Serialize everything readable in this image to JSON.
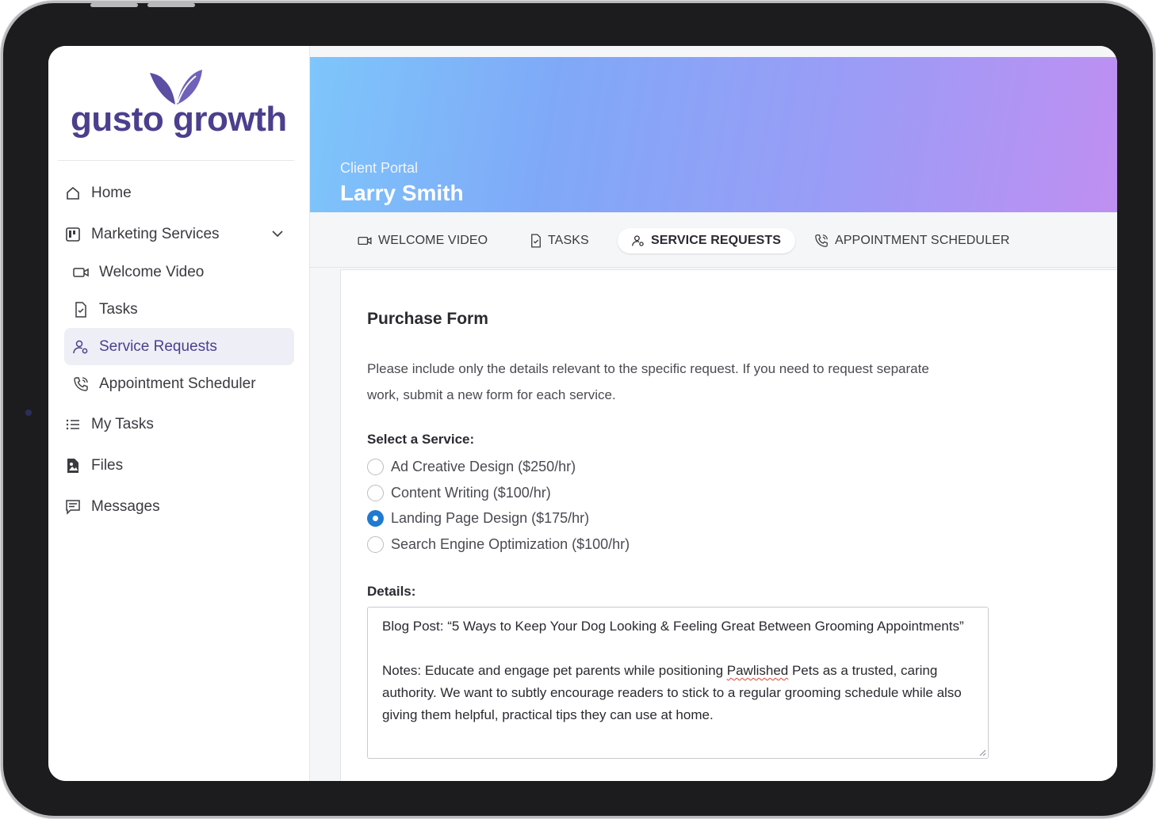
{
  "brand": {
    "name_part1": "gusto",
    "name_part2": "growth",
    "color": "#4b3f8e"
  },
  "sidebar": {
    "items": [
      {
        "label": "Home",
        "icon": "home-icon"
      },
      {
        "label": "Marketing Services",
        "icon": "kanban-icon",
        "expanded": true
      },
      {
        "label": "Welcome Video",
        "icon": "video-icon",
        "sub": true
      },
      {
        "label": "Tasks",
        "icon": "task-doc-icon",
        "sub": true
      },
      {
        "label": "Service Requests",
        "icon": "user-gear-icon",
        "sub": true,
        "active": true
      },
      {
        "label": "Appointment Scheduler",
        "icon": "phone-icon",
        "sub": true
      },
      {
        "label": "My Tasks",
        "icon": "list-icon"
      },
      {
        "label": "Files",
        "icon": "file-image-icon"
      },
      {
        "label": "Messages",
        "icon": "messages-icon"
      }
    ]
  },
  "banner": {
    "subtitle": "Client Portal",
    "title": "Larry Smith"
  },
  "tabs": [
    {
      "label": "WELCOME VIDEO",
      "icon": "video-icon"
    },
    {
      "label": "TASKS",
      "icon": "task-doc-icon"
    },
    {
      "label": "SERVICE REQUESTS",
      "icon": "user-gear-icon",
      "active": true
    },
    {
      "label": "APPOINTMENT SCHEDULER",
      "icon": "phone-icon"
    }
  ],
  "form": {
    "title": "Purchase Form",
    "description": "Please include only the details relevant to the specific request. If you need to request separate work, submit a new form for each service.",
    "service_label": "Select a Service:",
    "services": [
      {
        "label": "Ad Creative Design ($250/hr)",
        "checked": false
      },
      {
        "label": "Content Writing ($100/hr)",
        "checked": false
      },
      {
        "label": "Landing Page Design ($175/hr)",
        "checked": true
      },
      {
        "label": "Search Engine Optimization ($100/hr)",
        "checked": false
      }
    ],
    "details_label": "Details:",
    "details_line1": "Blog Post: “5 Ways to Keep Your Dog Looking & Feeling Great Between Grooming Appointments”",
    "details_notes_pre": "Notes: Educate and engage pet parents while positioning ",
    "details_notes_misspelled": "Pawlished",
    "details_notes_post": " Pets as a trusted, caring authority. We want to subtly encourage readers to stick to a regular grooming schedule while also giving them helpful, practical tips they can use at home."
  },
  "colors": {
    "accent": "#1f7ad1",
    "active_bg": "#eeeef6",
    "banner_start": "#7ec6fb",
    "banner_end": "#bf8ff2"
  }
}
